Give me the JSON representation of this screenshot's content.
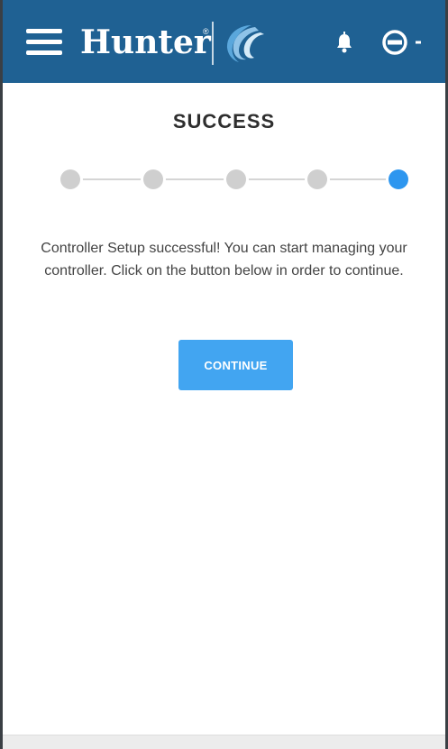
{
  "header": {
    "brand": "Hunter",
    "brand_mark": "®",
    "icons": {
      "menu": "hamburger-menu-icon",
      "logo": "swirl-logo-icon",
      "notifications": "bell-icon",
      "account": "user-circle-icon",
      "account_dropdown": "caret-down-icon"
    },
    "colors": {
      "bar": "#1f6193",
      "text": "#ffffff"
    }
  },
  "main": {
    "title": "SUCCESS",
    "stepper": {
      "total_steps": 5,
      "current_step": 5,
      "colors": {
        "inactive": "#cfcfcf",
        "active": "#2d96ef"
      }
    },
    "message": "Controller Setup successful! You can start managing your controller. Click on the button below in order to continue.",
    "continue_label": "CONTINUE",
    "colors": {
      "button": "#42a5f1"
    }
  }
}
